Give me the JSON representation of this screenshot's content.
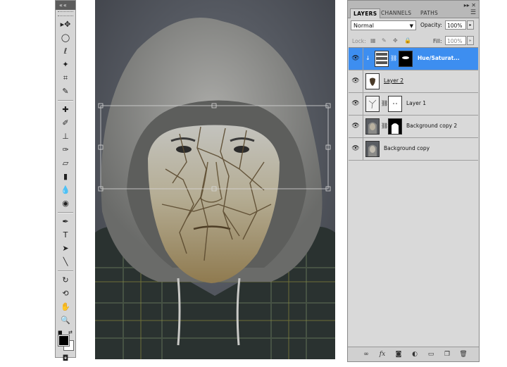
{
  "toolbox": {
    "title_chevrons": "««",
    "tools": [
      {
        "name": "move-tool-icon",
        "glyph": "▸✥"
      },
      {
        "name": "marquee-tool-icon",
        "glyph": "◯"
      },
      {
        "name": "lasso-tool-icon",
        "glyph": "ℓ"
      },
      {
        "name": "magic-wand-icon",
        "glyph": "✦"
      },
      {
        "name": "crop-tool-icon",
        "glyph": "⌗"
      },
      {
        "name": "eyedropper-icon",
        "glyph": "✎"
      },
      {
        "name": "healing-brush-icon",
        "glyph": "✚"
      },
      {
        "name": "brush-tool-icon",
        "glyph": "✐"
      },
      {
        "name": "clone-stamp-icon",
        "glyph": "⊥"
      },
      {
        "name": "history-brush-icon",
        "glyph": "✑"
      },
      {
        "name": "eraser-tool-icon",
        "glyph": "▱"
      },
      {
        "name": "gradient-tool-icon",
        "glyph": "▮"
      },
      {
        "name": "blur-tool-icon",
        "glyph": "💧"
      },
      {
        "name": "dodge-tool-icon",
        "glyph": "◉"
      },
      {
        "name": "pen-tool-icon",
        "glyph": "✒"
      },
      {
        "name": "type-tool-icon",
        "glyph": "T"
      },
      {
        "name": "path-selection-icon",
        "glyph": "➤"
      },
      {
        "name": "line-tool-icon",
        "glyph": "╲"
      },
      {
        "name": "3d-rotate-icon",
        "glyph": "↻"
      },
      {
        "name": "3d-orbit-icon",
        "glyph": "⟲"
      },
      {
        "name": "hand-tool-icon",
        "glyph": "✋"
      },
      {
        "name": "zoom-tool-icon",
        "glyph": "🔍"
      }
    ],
    "foreground_color": "#000000",
    "background_color": "#ffffff"
  },
  "layers_panel": {
    "tabs": [
      "LAYERS",
      "CHANNELS",
      "PATHS"
    ],
    "active_tab": "LAYERS",
    "blend_mode": "Normal",
    "opacity_label": "Opacity:",
    "opacity_value": "100%",
    "lock_label": "Lock:",
    "fill_label": "Fill:",
    "fill_value": "100%",
    "layers": [
      {
        "name": "Hue/Saturat...",
        "selected": true,
        "has_mask": true
      },
      {
        "name": "Layer 2",
        "selected": false,
        "has_mask": false
      },
      {
        "name": "Layer 1",
        "selected": false,
        "has_mask": true
      },
      {
        "name": "Background copy 2",
        "selected": false,
        "has_mask": true
      },
      {
        "name": "Background copy",
        "selected": false,
        "has_mask": false
      }
    ],
    "bottom_icons": [
      "link-layers-icon",
      "fx-icon",
      "add-mask-icon",
      "adjustment-layer-icon",
      "new-group-icon",
      "new-layer-icon",
      "delete-layer-icon"
    ],
    "accent_color": "#3d8ef0"
  }
}
